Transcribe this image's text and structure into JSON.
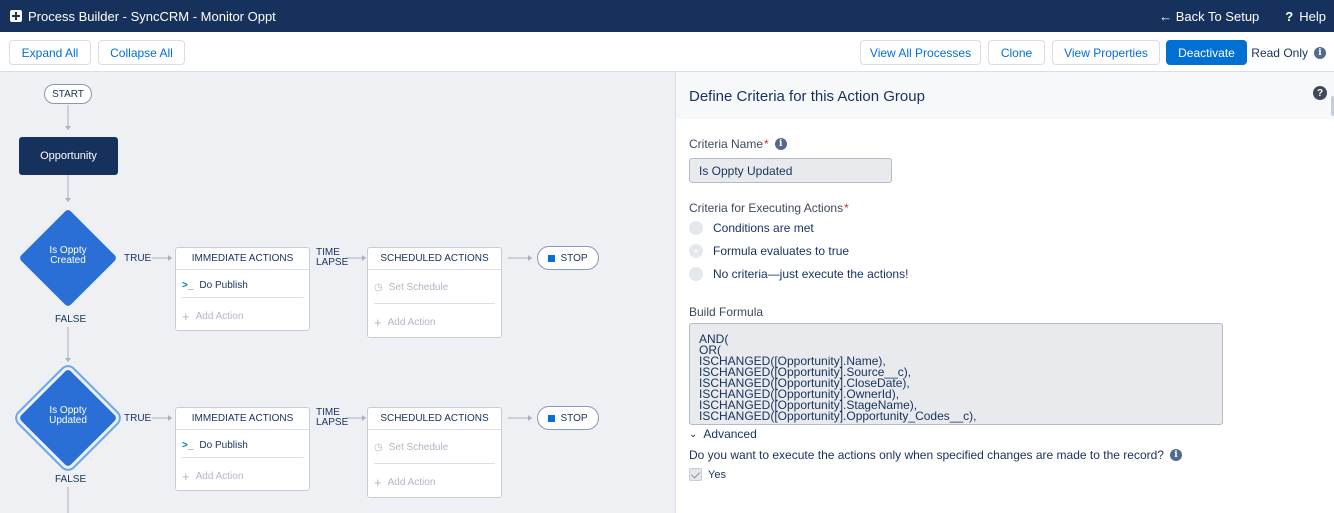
{
  "header": {
    "title": "Process Builder - SyncCRM - Monitor Oppt",
    "back_label": "← Back To Setup",
    "help_label": "Help",
    "help_icon": "?"
  },
  "toolbar": {
    "expand_all": "Expand All",
    "collapse_all": "Collapse All",
    "view_all_processes": "View All Processes",
    "clone": "Clone",
    "view_properties": "View Properties",
    "deactivate": "Deactivate",
    "read_only": "Read Only"
  },
  "canvas": {
    "start": "START",
    "object": "Opportunity",
    "groups": [
      {
        "criteria_label": [
          "Is Oppty",
          "Created"
        ],
        "true_label": "TRUE",
        "false_label": "FALSE",
        "immediate_header": "IMMEDIATE ACTIONS",
        "time_lapse": [
          "TIME",
          "LAPSE"
        ],
        "scheduled_header": "SCHEDULED ACTIONS",
        "action": "Do Publish",
        "add_action": "Add Action",
        "set_schedule": "Set Schedule",
        "stop": "STOP"
      },
      {
        "criteria_label": [
          "Is Oppty",
          "Updated"
        ],
        "true_label": "TRUE",
        "false_label": "FALSE",
        "immediate_header": "IMMEDIATE ACTIONS",
        "time_lapse": [
          "TIME",
          "LAPSE"
        ],
        "scheduled_header": "SCHEDULED ACTIONS",
        "action": "Do Publish",
        "add_action": "Add Action",
        "set_schedule": "Set Schedule",
        "stop": "STOP"
      }
    ]
  },
  "panel": {
    "title": "Define Criteria for this Action Group",
    "criteria_name_label": "Criteria Name",
    "criteria_name_value": "Is Oppty Updated",
    "executing_label": "Criteria for Executing Actions",
    "options": [
      "Conditions are met",
      "Formula evaluates to true",
      "No criteria—just execute the actions!"
    ],
    "selected_option": 1,
    "build_formula_label": "Build Formula",
    "formula_lines": [
      "AND(",
      "OR(",
      "ISCHANGED([Opportunity].Name),",
      "ISCHANGED([Opportunity].Source__c),",
      "ISCHANGED([Opportunity].CloseDate),",
      "ISCHANGED([Opportunity].OwnerId),",
      "ISCHANGED([Opportunity].StageName),",
      "ISCHANGED([Opportunity].Opportunity_Codes__c),"
    ],
    "advanced_label": "Advanced",
    "changes_question": "Do you want to execute the actions only when specified changes are made to the record?",
    "yes_label": "Yes",
    "required_mark": "*",
    "info_icon": "i"
  },
  "colors": {
    "header_bg": "#16325c",
    "brand": "#0070d2",
    "diamond": "#2a6fd6",
    "canvas_bg": "#eef0f3"
  }
}
